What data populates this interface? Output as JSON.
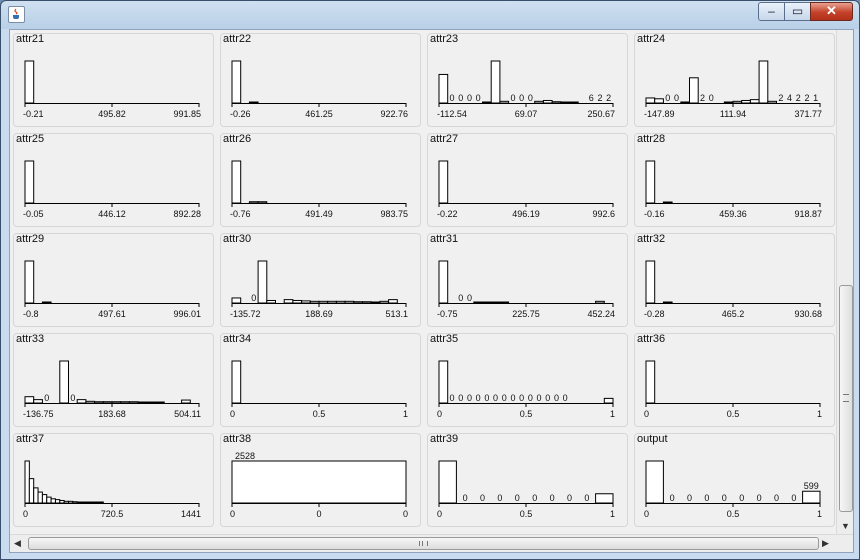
{
  "window": {
    "title": "",
    "buttons": [
      "minimize",
      "maximize",
      "close"
    ]
  },
  "chart_data": [
    {
      "type": "bar",
      "title": "attr21",
      "x_ticks": [
        "-0.21",
        "495.82",
        "991.85"
      ],
      "values": [
        1,
        0,
        0,
        0,
        0,
        0,
        0,
        0,
        0,
        0,
        0,
        0,
        0,
        0,
        0,
        0,
        0,
        0,
        0,
        0
      ],
      "labels": []
    },
    {
      "type": "bar",
      "title": "attr22",
      "x_ticks": [
        "-0.26",
        "461.25",
        "922.76"
      ],
      "values": [
        1,
        0,
        0.02,
        0,
        0,
        0,
        0,
        0,
        0,
        0,
        0,
        0,
        0,
        0,
        0,
        0,
        0,
        0,
        0,
        0
      ],
      "labels": []
    },
    {
      "type": "bar",
      "title": "attr23",
      "x_ticks": [
        "-112.54",
        "69.07",
        "250.67"
      ],
      "values": [
        0.68,
        0,
        0,
        0,
        0,
        0.02,
        1,
        0.04,
        0,
        0,
        0,
        0.04,
        0.06,
        0.03,
        0.02,
        0.01,
        0,
        0,
        0,
        0
      ],
      "labels": [
        {
          "i": 1,
          "t": "0"
        },
        {
          "i": 2,
          "t": "0"
        },
        {
          "i": 3,
          "t": "0"
        },
        {
          "i": 4,
          "t": "0"
        },
        {
          "i": 8,
          "t": "0"
        },
        {
          "i": 9,
          "t": "0"
        },
        {
          "i": 10,
          "t": "0"
        },
        {
          "i": 17,
          "t": "6"
        },
        {
          "i": 18,
          "t": "2"
        },
        {
          "i": 19,
          "t": "2"
        }
      ]
    },
    {
      "type": "bar",
      "title": "attr24",
      "x_ticks": [
        "-147.89",
        "111.94",
        "371.77"
      ],
      "values": [
        0.12,
        0.1,
        0,
        0,
        0.02,
        0.6,
        0,
        0,
        0,
        0.01,
        0.04,
        0.06,
        0.08,
        1,
        0.04,
        0,
        0,
        0,
        0,
        0
      ],
      "labels": [
        {
          "i": 2,
          "t": "0"
        },
        {
          "i": 3,
          "t": "0"
        },
        {
          "i": 6,
          "t": "2"
        },
        {
          "i": 7,
          "t": "0"
        },
        {
          "i": 15,
          "t": "2"
        },
        {
          "i": 16,
          "t": "4"
        },
        {
          "i": 17,
          "t": "2"
        },
        {
          "i": 18,
          "t": "2"
        },
        {
          "i": 19,
          "t": "1"
        }
      ]
    },
    {
      "type": "bar",
      "title": "attr25",
      "x_ticks": [
        "-0.05",
        "446.12",
        "892.28"
      ],
      "values": [
        1,
        0,
        0,
        0,
        0,
        0,
        0,
        0,
        0,
        0,
        0,
        0,
        0,
        0,
        0,
        0,
        0,
        0,
        0,
        0
      ],
      "labels": []
    },
    {
      "type": "bar",
      "title": "attr26",
      "x_ticks": [
        "-0.76",
        "491.49",
        "983.75"
      ],
      "values": [
        1,
        0,
        0.03,
        0.03,
        0,
        0,
        0,
        0,
        0,
        0,
        0,
        0,
        0,
        0,
        0,
        0,
        0,
        0,
        0,
        0
      ],
      "labels": []
    },
    {
      "type": "bar",
      "title": "attr27",
      "x_ticks": [
        "-0.22",
        "496.19",
        "992.6"
      ],
      "values": [
        1,
        0,
        0,
        0,
        0,
        0,
        0,
        0,
        0,
        0,
        0,
        0,
        0,
        0,
        0,
        0,
        0,
        0,
        0,
        0
      ],
      "labels": []
    },
    {
      "type": "bar",
      "title": "attr28",
      "x_ticks": [
        "-0.16",
        "459.36",
        "918.87"
      ],
      "values": [
        1,
        0,
        0.02,
        0,
        0,
        0,
        0,
        0,
        0,
        0,
        0,
        0,
        0,
        0,
        0,
        0,
        0,
        0,
        0,
        0
      ],
      "labels": []
    },
    {
      "type": "bar",
      "title": "attr29",
      "x_ticks": [
        "-0.8",
        "497.61",
        "996.01"
      ],
      "values": [
        1,
        0,
        0.02,
        0,
        0,
        0,
        0,
        0,
        0,
        0,
        0,
        0,
        0,
        0,
        0,
        0,
        0,
        0,
        0,
        0
      ],
      "labels": []
    },
    {
      "type": "bar",
      "title": "attr30",
      "x_ticks": [
        "-135.72",
        "188.69",
        "513.1"
      ],
      "values": [
        0.12,
        0,
        0,
        1,
        0.06,
        0,
        0.08,
        0.06,
        0.05,
        0.04,
        0.04,
        0.04,
        0.04,
        0.04,
        0.03,
        0.03,
        0.02,
        0.04,
        0.08,
        0
      ],
      "labels": [
        {
          "i": 2,
          "t": "0"
        }
      ]
    },
    {
      "type": "bar",
      "title": "attr31",
      "x_ticks": [
        "-0.75",
        "225.75",
        "452.24"
      ],
      "values": [
        1,
        0,
        0,
        0,
        0.02,
        0.02,
        0.02,
        0.01,
        0,
        0,
        0,
        0,
        0,
        0,
        0,
        0,
        0,
        0,
        0.04,
        0
      ],
      "labels": [
        {
          "i": 2,
          "t": "0"
        },
        {
          "i": 3,
          "t": "0"
        }
      ]
    },
    {
      "type": "bar",
      "title": "attr32",
      "x_ticks": [
        "-0.28",
        "465.2",
        "930.68"
      ],
      "values": [
        1,
        0,
        0.02,
        0,
        0,
        0,
        0,
        0,
        0,
        0,
        0,
        0,
        0,
        0,
        0,
        0,
        0,
        0,
        0,
        0
      ],
      "labels": []
    },
    {
      "type": "bar",
      "title": "attr33",
      "x_ticks": [
        "-136.75",
        "183.68",
        "504.11"
      ],
      "values": [
        0.15,
        0.08,
        0,
        0,
        1,
        0,
        0.08,
        0.04,
        0.03,
        0.03,
        0.03,
        0.03,
        0.03,
        0.02,
        0.02,
        0.01,
        0,
        0,
        0.07,
        0
      ],
      "labels": [
        {
          "i": 2,
          "t": "0"
        },
        {
          "i": 5,
          "t": "0"
        }
      ]
    },
    {
      "type": "bar",
      "title": "attr34",
      "x_ticks": [
        "0",
        "0.5",
        "1"
      ],
      "values": [
        1,
        0,
        0,
        0,
        0,
        0,
        0,
        0,
        0,
        0,
        0,
        0,
        0,
        0,
        0,
        0,
        0,
        0,
        0,
        0
      ],
      "labels": []
    },
    {
      "type": "bar",
      "title": "attr35",
      "x_ticks": [
        "0",
        "0.5",
        "1"
      ],
      "values": [
        1,
        0,
        0,
        0,
        0,
        0,
        0,
        0,
        0,
        0,
        0,
        0,
        0,
        0,
        0,
        0,
        0,
        0,
        0,
        0.11
      ],
      "labels": [
        {
          "i": 1,
          "t": "0"
        },
        {
          "i": 2,
          "t": "0"
        },
        {
          "i": 3,
          "t": "0"
        },
        {
          "i": 4,
          "t": "0"
        },
        {
          "i": 5,
          "t": "0"
        },
        {
          "i": 6,
          "t": "0"
        },
        {
          "i": 7,
          "t": "0"
        },
        {
          "i": 8,
          "t": "0"
        },
        {
          "i": 9,
          "t": "0"
        },
        {
          "i": 10,
          "t": "0"
        },
        {
          "i": 11,
          "t": "0"
        },
        {
          "i": 12,
          "t": "0"
        },
        {
          "i": 13,
          "t": "0"
        },
        {
          "i": 14,
          "t": "0"
        }
      ]
    },
    {
      "type": "bar",
      "title": "attr36",
      "x_ticks": [
        "0",
        "0.5",
        "1"
      ],
      "values": [
        1,
        0,
        0,
        0,
        0,
        0,
        0,
        0,
        0,
        0,
        0,
        0,
        0,
        0,
        0,
        0,
        0,
        0,
        0,
        0
      ],
      "labels": []
    },
    {
      "type": "bar",
      "title": "attr37",
      "x_ticks": [
        "0",
        "720.5",
        "1441"
      ],
      "values": [
        1,
        0.58,
        0.36,
        0.26,
        0.2,
        0.14,
        0.1,
        0.08,
        0.06,
        0.04,
        0.04,
        0.03,
        0.02,
        0.02,
        0.02,
        0.01,
        0.01,
        0.01,
        0,
        0,
        0,
        0,
        0,
        0,
        0,
        0,
        0,
        0,
        0,
        0,
        0,
        0,
        0,
        0,
        0,
        0,
        0,
        0,
        0,
        0
      ],
      "labels": []
    },
    {
      "type": "bar",
      "title": "attr38",
      "x_ticks": [
        "0",
        "0",
        "0"
      ],
      "values": [
        1
      ],
      "labels": [
        {
          "i": 0,
          "t": "2528"
        }
      ]
    },
    {
      "type": "bar",
      "title": "attr39",
      "x_ticks": [
        "0",
        "0.5",
        "1"
      ],
      "values": [
        1,
        0,
        0,
        0,
        0,
        0,
        0,
        0,
        0,
        0.22
      ],
      "labels": [
        {
          "i": 1,
          "t": "0"
        },
        {
          "i": 2,
          "t": "0"
        },
        {
          "i": 3,
          "t": "0"
        },
        {
          "i": 4,
          "t": "0"
        },
        {
          "i": 5,
          "t": "0"
        },
        {
          "i": 6,
          "t": "0"
        },
        {
          "i": 7,
          "t": "0"
        },
        {
          "i": 8,
          "t": "0"
        }
      ]
    },
    {
      "type": "bar",
      "title": "output",
      "x_ticks": [
        "0",
        "0.5",
        "1"
      ],
      "values": [
        1,
        0,
        0,
        0,
        0,
        0,
        0,
        0,
        0,
        0.28
      ],
      "labels": [
        {
          "i": 1,
          "t": "0"
        },
        {
          "i": 2,
          "t": "0"
        },
        {
          "i": 3,
          "t": "0"
        },
        {
          "i": 4,
          "t": "0"
        },
        {
          "i": 5,
          "t": "0"
        },
        {
          "i": 6,
          "t": "0"
        },
        {
          "i": 7,
          "t": "0"
        },
        {
          "i": 8,
          "t": "0"
        },
        {
          "i": 9,
          "t": "599"
        }
      ]
    }
  ]
}
